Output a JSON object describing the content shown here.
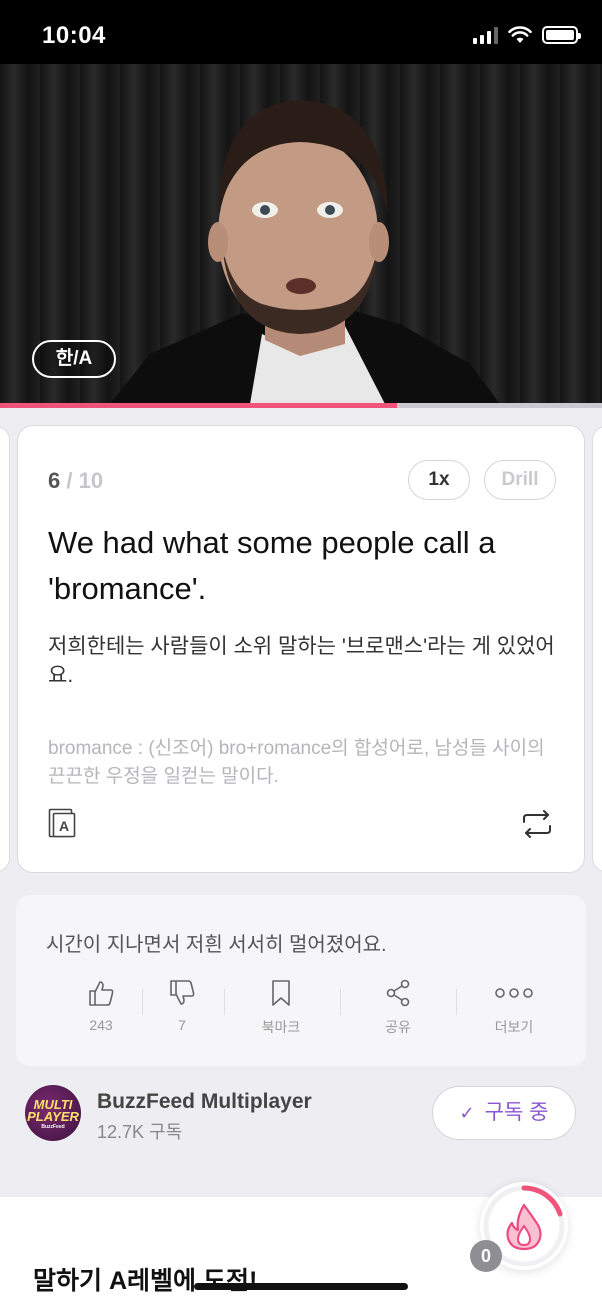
{
  "status_bar": {
    "time": "10:04"
  },
  "video": {
    "lang_toggle": "한/A",
    "progress_fraction": 0.66,
    "progress_color": "#f2537a"
  },
  "card": {
    "current": "6",
    "total": "/ 10",
    "speed_label": "1x",
    "drill_label": "Drill",
    "sentence": "We had what some people call a 'bromance'.",
    "translation": "저희한테는 사람들이 소위 말하는  '브로맨스'라는 게 있었어요.",
    "note": "bromance : (신조어) bro+romance의 합성어로, 남성들 사이의 끈끈한 우정을 일컫는 말이다.",
    "dict_icon_letter": "A"
  },
  "info": {
    "next_sentence": "시간이 지나면서 저흰 서서히 멀어졌어요.",
    "actions": [
      {
        "icon": "thumbs-up-icon",
        "label": "243"
      },
      {
        "icon": "thumbs-down-icon",
        "label": "7"
      },
      {
        "icon": "bookmark-icon",
        "label": "북마크"
      },
      {
        "icon": "share-icon",
        "label": "공유"
      },
      {
        "icon": "more-icon",
        "label": "더보기"
      }
    ]
  },
  "channel": {
    "avatar_line1": "MULTI",
    "avatar_line2": "PLAYER",
    "avatar_line3": "BuzzFeed",
    "name": "BuzzFeed Multiplayer",
    "subscribers": "12.7K 구독",
    "subscribe_label": "구독 중"
  },
  "bottom": {
    "title": "말하기 A레벨에 도전!",
    "badge_count": "0"
  },
  "colors": {
    "accent_purple": "#8a56d6",
    "accent_pink": "#f2537a"
  }
}
